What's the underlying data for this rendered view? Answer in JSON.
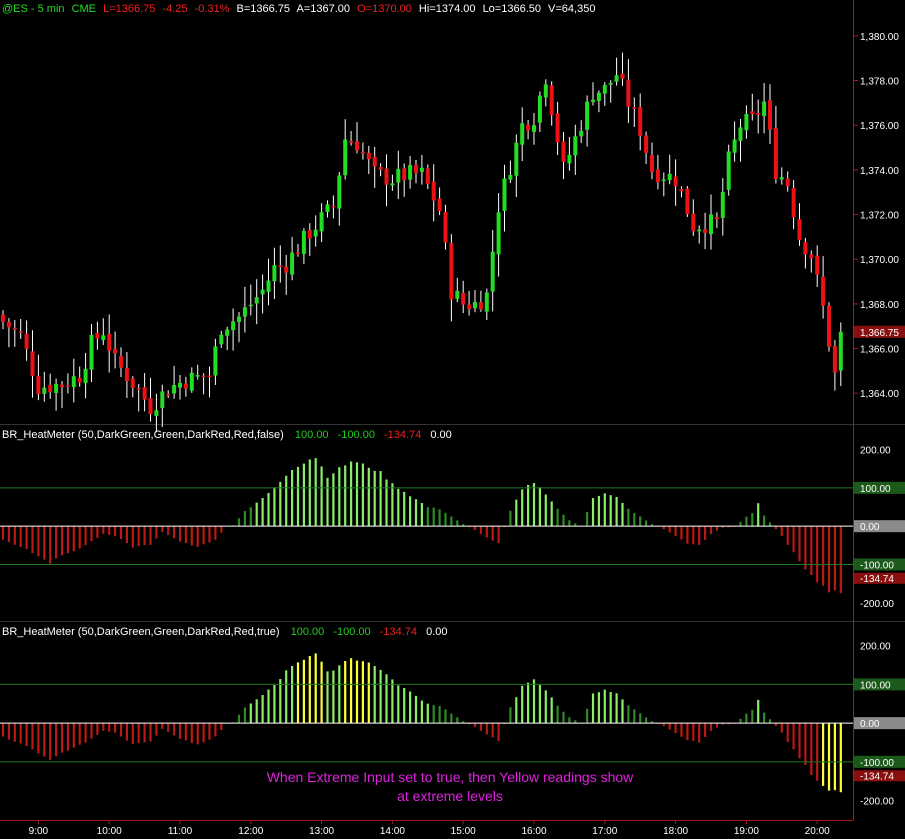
{
  "colors": {
    "background": "#000000",
    "up_candle": "#22dd22",
    "down_candle": "#ee1111",
    "wick": "#ffffff",
    "pos_bright": "#88ee66",
    "pos_dark": "#2e8a22",
    "neg_dark": "#bb1a12",
    "extreme": "#ffff33",
    "ref_line": "#1c7a1c",
    "zero_line": "#ffffff",
    "price_label_bg": "#8a1010",
    "zero_label_bg": "#8a8a8a",
    "ref_pos_label_bg": "#1c5a1c",
    "ref_neg_label_bg": "#1c5a1c",
    "last_neg_label_bg": "#8a1010",
    "annotation": "#e020e0",
    "axis": "#cc2222"
  },
  "header": {
    "symbol": "@ES - 5 min",
    "exchange": "CME",
    "last": "L=1366.75",
    "change": "-4.25",
    "change_pct": "-0.31%",
    "bid": "B=1366.75",
    "ask": "A=1367.00",
    "open": "O=1370.00",
    "high": "Hi=1374.00",
    "low": "Lo=1366.50",
    "volume": "V=64,350"
  },
  "price_panel": {
    "y_ticks": [
      "1,364.00",
      "1,366.00",
      "1,368.00",
      "1,370.00",
      "1,372.00",
      "1,374.00",
      "1,376.00",
      "1,378.00",
      "1,380.00"
    ],
    "tick_values": [
      1364,
      1366,
      1368,
      1370,
      1372,
      1374,
      1376,
      1378,
      1380
    ],
    "last_price_label": "1,366.75",
    "last_price_value": 1366.75,
    "ylim": [
      1362.8,
      1380.8
    ]
  },
  "indicator_panels": [
    {
      "title": "BR_HeatMeter (50,DarkGreen,Green,DarkRed,Red,false)",
      "val_pos": "100.00",
      "val_neg": "-100.00",
      "val_last": "-134.74",
      "val_zero": "0.00",
      "y_ticks": [
        "200.00",
        "-200.00"
      ],
      "ref_pos_label": "100.00",
      "ref_neg_label": "-100.00",
      "last_label": "-134.74",
      "zero_label": "0.00",
      "extreme": false,
      "ylim": [
        -245,
        225
      ],
      "refs": [
        100,
        -100
      ]
    },
    {
      "title": "BR_HeatMeter (50,DarkGreen,Green,DarkRed,Red,true)",
      "val_pos": "100.00",
      "val_neg": "-100.00",
      "val_last": "-134.74",
      "val_zero": "0.00",
      "y_ticks": [
        "200.00",
        "-200.00"
      ],
      "ref_pos_label": "100.00",
      "ref_neg_label": "-100.00",
      "last_label": "-134.74",
      "zero_label": "0.00",
      "extreme": true,
      "ylim": [
        -245,
        225
      ],
      "refs": [
        100,
        -100
      ]
    }
  ],
  "annotation": {
    "line1": "When Extreme Input set to true, then Yellow readings show",
    "line2": "at extreme levels"
  },
  "x_axis": {
    "labels": [
      "9:00",
      "10:00",
      "11:00",
      "12:00",
      "13:00",
      "14:00",
      "15:00",
      "16:00",
      "17:00",
      "18:00",
      "19:00",
      "20:00"
    ]
  },
  "chart_data": [
    {
      "type": "candlestick",
      "title": "",
      "bars": 143,
      "x_labels": [
        "9:00",
        "10:00",
        "11:00",
        "12:00",
        "13:00",
        "14:00",
        "15:00",
        "16:00",
        "17:00",
        "18:00",
        "19:00",
        "20:00"
      ],
      "x_label_bar_index": [
        6,
        18,
        30,
        42,
        54,
        66,
        78,
        90,
        102,
        114,
        126,
        138
      ],
      "close_path_keypoints": [
        [
          0,
          1367.2
        ],
        [
          3,
          1366.6
        ],
        [
          6,
          1364.3
        ],
        [
          10,
          1364.4
        ],
        [
          13,
          1364.8
        ],
        [
          15,
          1366.2
        ],
        [
          17,
          1366.8
        ],
        [
          19,
          1365.4
        ],
        [
          21,
          1364.8
        ],
        [
          25,
          1363.4
        ],
        [
          28,
          1364.2
        ],
        [
          31,
          1364.6
        ],
        [
          35,
          1364.8
        ],
        [
          37,
          1367.0
        ],
        [
          40,
          1367.4
        ],
        [
          44,
          1368.6
        ],
        [
          46,
          1369.6
        ],
        [
          48,
          1369.8
        ],
        [
          52,
          1371.2
        ],
        [
          56,
          1372.4
        ],
        [
          58,
          1375.4
        ],
        [
          60,
          1375.2
        ],
        [
          63,
          1373.8
        ],
        [
          66,
          1373.6
        ],
        [
          69,
          1373.8
        ],
        [
          71,
          1373.8
        ],
        [
          74,
          1372.2
        ],
        [
          76,
          1368.6
        ],
        [
          78,
          1368.0
        ],
        [
          80,
          1368.0
        ],
        [
          82,
          1368.4
        ],
        [
          84,
          1372.4
        ],
        [
          86,
          1374.2
        ],
        [
          88,
          1376.0
        ],
        [
          90,
          1376.4
        ],
        [
          92,
          1378.2
        ],
        [
          95,
          1374.0
        ],
        [
          97,
          1375.4
        ],
        [
          100,
          1377.5
        ],
        [
          102,
          1377.6
        ],
        [
          104,
          1378.3
        ],
        [
          106,
          1377.0
        ],
        [
          108,
          1375.8
        ],
        [
          110,
          1374.0
        ],
        [
          112,
          1373.8
        ],
        [
          114,
          1373.6
        ],
        [
          117,
          1371.5
        ],
        [
          119,
          1371.6
        ],
        [
          121,
          1371.6
        ],
        [
          123,
          1374.4
        ],
        [
          125,
          1376.0
        ],
        [
          127,
          1376.2
        ],
        [
          129,
          1377.0
        ],
        [
          131,
          1374.0
        ],
        [
          133,
          1373.4
        ],
        [
          135,
          1371.0
        ],
        [
          137,
          1370.2
        ],
        [
          139,
          1367.8
        ],
        [
          141,
          1364.8
        ],
        [
          142,
          1365.4
        ]
      ],
      "last_close": 1366.75,
      "ylim": [
        1362.8,
        1380.8
      ],
      "y_ticks": [
        1364,
        1366,
        1368,
        1370,
        1372,
        1374,
        1376,
        1378,
        1380
      ]
    },
    {
      "type": "bar",
      "title": "BR_HeatMeter (50,DarkGreen,Green,DarkRed,Red,false)",
      "note": "histogram approximated from keypoints [bar_index, value]",
      "keypoints": [
        [
          0,
          -35
        ],
        [
          4,
          -60
        ],
        [
          8,
          -95
        ],
        [
          11,
          -70
        ],
        [
          14,
          -50
        ],
        [
          17,
          -20
        ],
        [
          19,
          -25
        ],
        [
          22,
          -55
        ],
        [
          25,
          -48
        ],
        [
          27,
          -15
        ],
        [
          30,
          -40
        ],
        [
          33,
          -55
        ],
        [
          36,
          -35
        ],
        [
          38,
          0
        ],
        [
          39,
          2
        ],
        [
          41,
          40
        ],
        [
          43,
          60
        ],
        [
          46,
          100
        ],
        [
          49,
          150
        ],
        [
          52,
          175
        ],
        [
          53,
          180
        ],
        [
          55,
          130
        ],
        [
          57,
          150
        ],
        [
          59,
          170
        ],
        [
          62,
          155
        ],
        [
          64,
          140
        ],
        [
          66,
          110
        ],
        [
          68,
          90
        ],
        [
          70,
          70
        ],
        [
          72,
          50
        ],
        [
          74,
          45
        ],
        [
          76,
          25
        ],
        [
          78,
          5
        ],
        [
          80,
          -10
        ],
        [
          82,
          -30
        ],
        [
          84,
          -45
        ],
        [
          86,
          40
        ],
        [
          88,
          95
        ],
        [
          90,
          115
        ],
        [
          92,
          85
        ],
        [
          94,
          45
        ],
        [
          96,
          15
        ],
        [
          98,
          0
        ],
        [
          100,
          75
        ],
        [
          102,
          85
        ],
        [
          104,
          75
        ],
        [
          106,
          45
        ],
        [
          108,
          25
        ],
        [
          110,
          5
        ],
        [
          112,
          -8
        ],
        [
          114,
          -25
        ],
        [
          116,
          -45
        ],
        [
          118,
          -50
        ],
        [
          120,
          -20
        ],
        [
          122,
          -4
        ],
        [
          124,
          -2
        ],
        [
          126,
          25
        ],
        [
          127,
          35
        ],
        [
          128,
          60
        ],
        [
          129,
          28
        ],
        [
          130,
          10
        ],
        [
          132,
          -25
        ],
        [
          134,
          -70
        ],
        [
          136,
          -110
        ],
        [
          138,
          -150
        ],
        [
          140,
          -170
        ],
        [
          142,
          -175
        ]
      ],
      "ylim": [
        -245,
        225
      ],
      "reference_lines": [
        100,
        -100
      ],
      "extreme": false
    },
    {
      "type": "bar",
      "title": "BR_HeatMeter (50,DarkGreen,Green,DarkRed,Red,true)",
      "note": "same values as panel above; bars at extreme levels drawn in yellow",
      "extreme": true,
      "extreme_threshold": 150,
      "ylim": [
        -245,
        225
      ],
      "reference_lines": [
        100,
        -100
      ]
    }
  ]
}
